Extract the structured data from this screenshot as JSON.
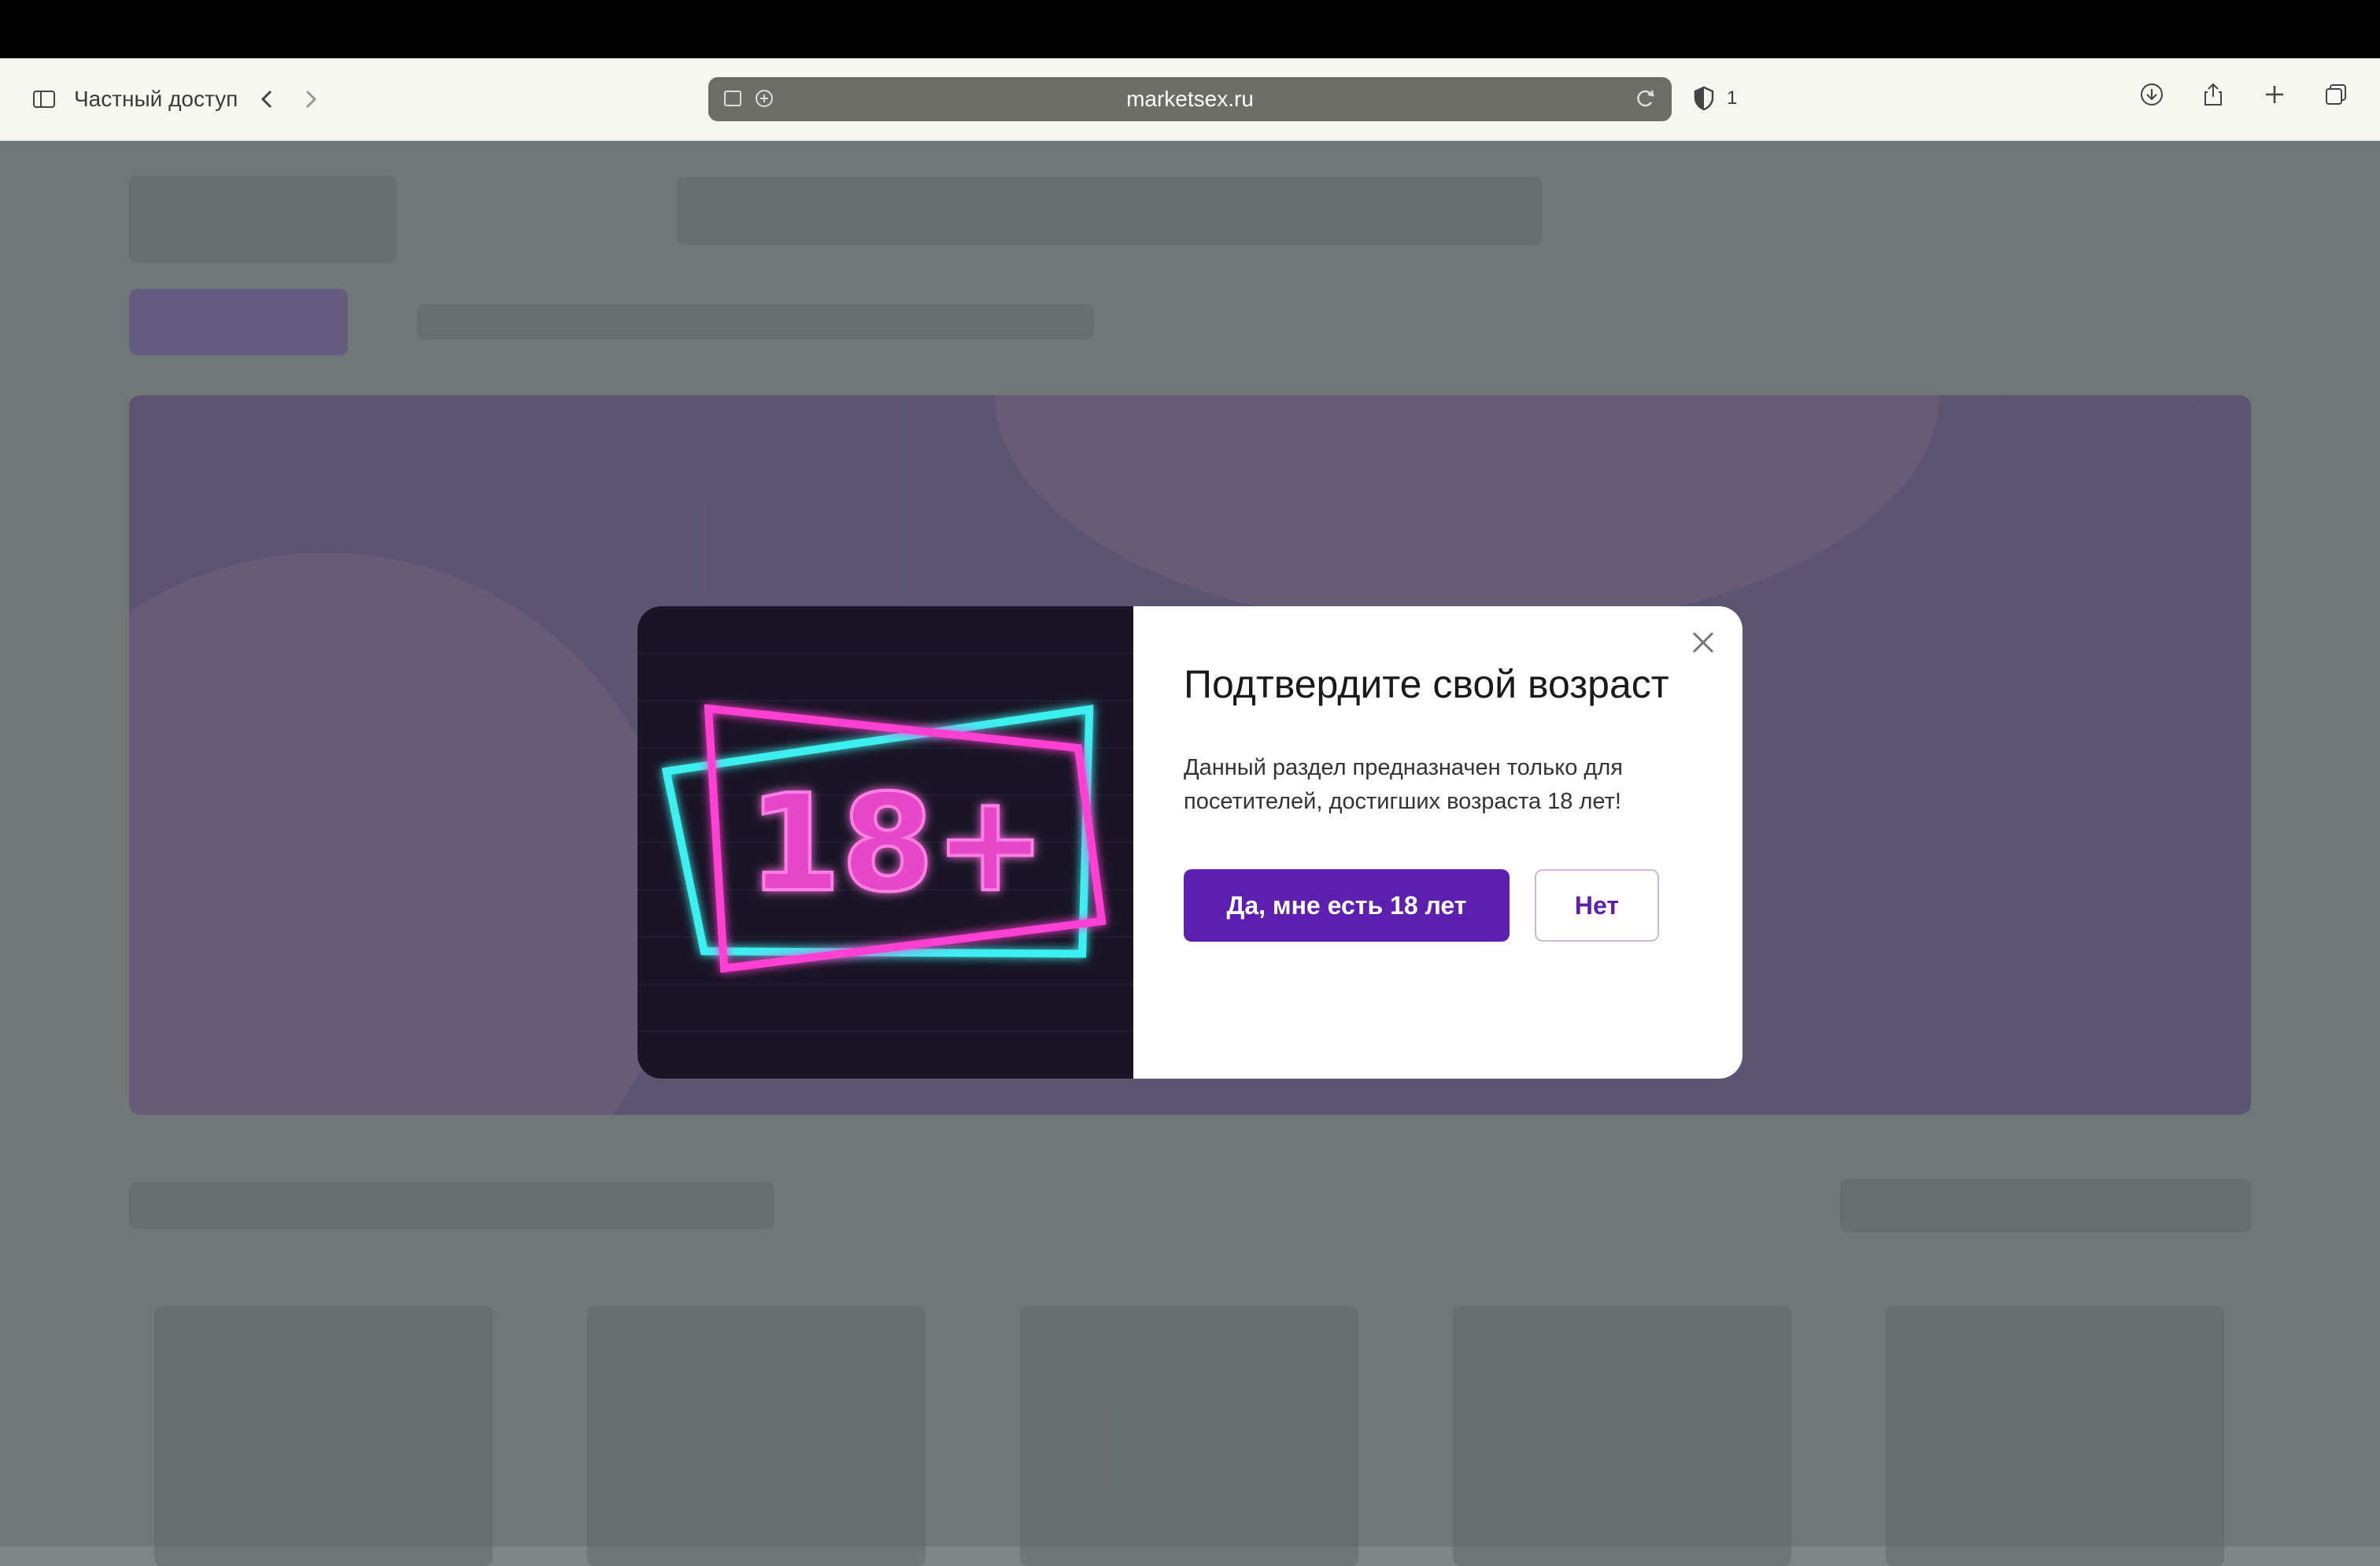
{
  "browser": {
    "private_label": "Частный доступ",
    "url": "marketsex.ru",
    "tracker_count": "1"
  },
  "modal": {
    "title": "Подтвердите свой возраст",
    "text": "Данный раздел предназначен только для посетителей, достигших возраста 18 лет!",
    "yes_label": "Да, мне есть 18 лет",
    "no_label": "Нет",
    "age_badge": "18+"
  },
  "colors": {
    "accent": "#5c1fb0",
    "neon_pink": "#ff3fd2",
    "neon_cyan": "#3ef0f0"
  }
}
